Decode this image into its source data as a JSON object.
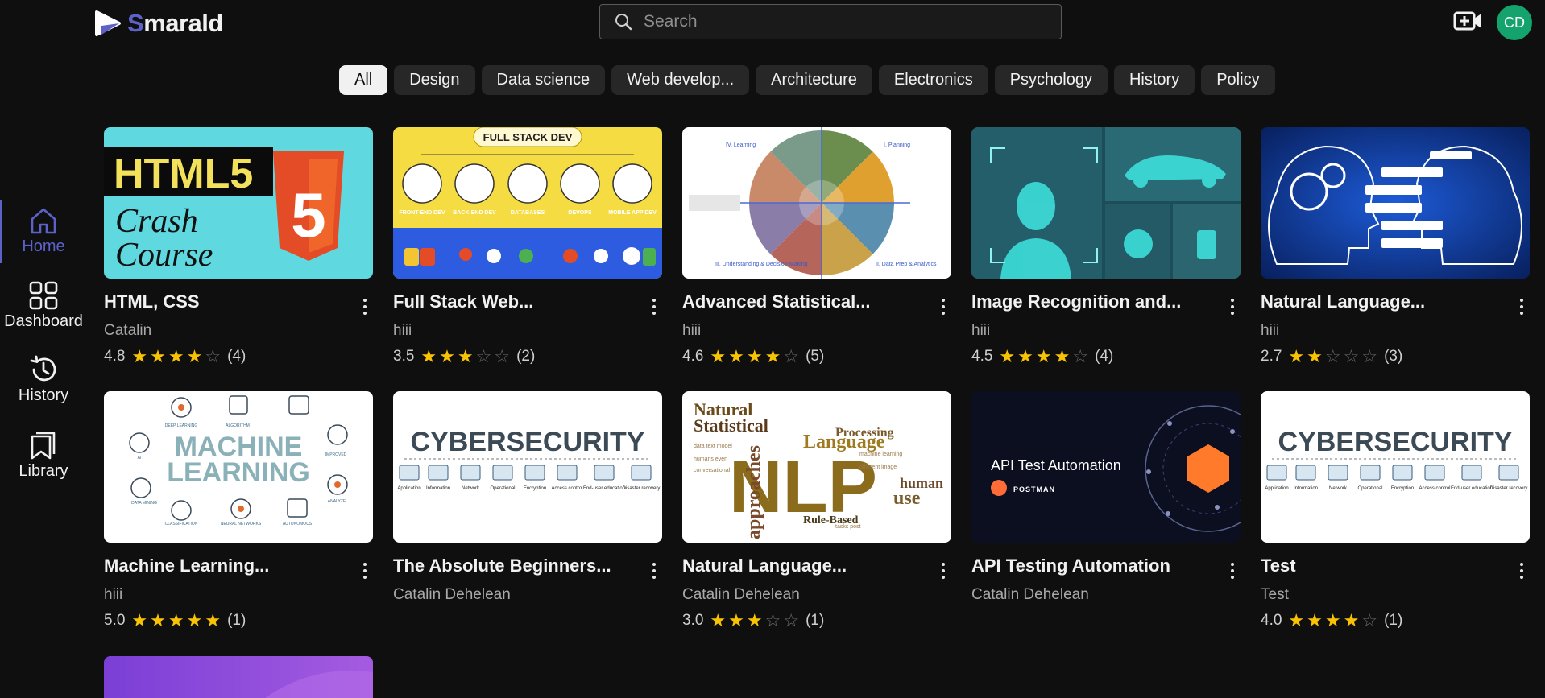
{
  "app": {
    "name_first": "S",
    "name_rest": "marald"
  },
  "search": {
    "placeholder": "Search"
  },
  "user": {
    "initials": "CD"
  },
  "colors": {
    "accent": "#5d62c9",
    "star": "#f8c304",
    "avatar": "#14a36c"
  },
  "chips": [
    "All",
    "Design",
    "Data science",
    "Web develop...",
    "Architecture",
    "Electronics",
    "Psychology",
    "History",
    "Policy"
  ],
  "sidebar": {
    "items": [
      {
        "label": "Home",
        "icon": "home-icon"
      },
      {
        "label": "Dashboard",
        "icon": "dashboard-icon"
      },
      {
        "label": "History",
        "icon": "history-icon"
      },
      {
        "label": "Library",
        "icon": "library-icon"
      }
    ]
  },
  "courses": [
    {
      "title": "HTML, CSS",
      "author": "Catalin",
      "rating": "4.8",
      "count": "(4)",
      "stars": 4,
      "thumb_text": [
        "HTML5",
        "Crash",
        "Course"
      ]
    },
    {
      "title": "Full Stack Web...",
      "author": "hiii",
      "rating": "3.5",
      "count": "(2)",
      "stars": 3,
      "thumb_text": [
        "FULL STACK DEV",
        "FRONT-END DEV",
        "BACK-END DEV",
        "DATABASES",
        "DEVOPS",
        "MOBILE APP DEV"
      ]
    },
    {
      "title": "Advanced Statistical...",
      "author": "hiii",
      "rating": "4.6",
      "count": "(5)",
      "stars": 4,
      "thumb_text": [
        "IV. Learning",
        "I. Planning",
        "III. Understanding & Decision-Making",
        "II. Data Prep & Analytics"
      ]
    },
    {
      "title": "Image Recognition and...",
      "author": "hiii",
      "rating": "4.5",
      "count": "(4)",
      "stars": 4,
      "thumb_text": []
    },
    {
      "title": "Natural Language...",
      "author": "hiii",
      "rating": "2.7",
      "count": "(3)",
      "stars": 2,
      "thumb_text": []
    },
    {
      "title": "Machine Learning...",
      "author": "hiii",
      "rating": "5.0",
      "count": "(1)",
      "stars": 5,
      "thumb_text": [
        "MACHINE",
        "LEARNING",
        "DEEP LEARNING",
        "ALGORITHM",
        "IMPROVED",
        "AI",
        "ANALYZE",
        "DATA MINING",
        "CLASSIFICATION",
        "NEURAL NETWORKS",
        "AUTONOMOUS"
      ]
    },
    {
      "title": "The Absolute Beginners...",
      "author": "Catalin Dehelean",
      "rating": "",
      "count": "",
      "stars": 0,
      "thumb_text": [
        "CYBERSECURITY",
        "Application",
        "Information",
        "Network",
        "Operational",
        "Encryption",
        "Access control",
        "End-user education",
        "Disaster recovery"
      ]
    },
    {
      "title": "Natural Language...",
      "author": "Catalin Dehelean",
      "rating": "3.0",
      "count": "(1)",
      "stars": 3,
      "thumb_text": [
        "NLP",
        "Natural",
        "Statistical",
        "Language",
        "Processing",
        "approaches",
        "Rule-Based",
        "human",
        "use"
      ]
    },
    {
      "title": "API Testing Automation",
      "author": "Catalin Dehelean",
      "rating": "",
      "count": "",
      "stars": 0,
      "thumb_text": [
        "API Test Automation",
        "POSTMAN"
      ]
    },
    {
      "title": "Test",
      "author": "Test",
      "rating": "4.0",
      "count": "(1)",
      "stars": 4,
      "thumb_text": [
        "CYBERSECURITY",
        "Application",
        "Information",
        "Network",
        "Operational",
        "Encryption",
        "Access control",
        "End-user education",
        "Disaster recovery"
      ]
    }
  ]
}
